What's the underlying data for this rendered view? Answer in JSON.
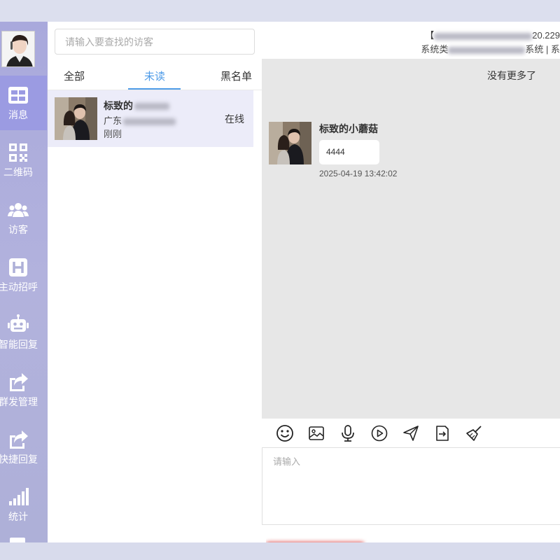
{
  "colors": {
    "accent": "#4e9be8",
    "sidebar": "#aeb0d8",
    "sidebar_active": "#9b9be2",
    "selected_row": "#ececf9",
    "chat_bg": "#e7e7e7"
  },
  "sidebar": {
    "items": [
      {
        "label": "消息",
        "icon": "message-grid-icon"
      },
      {
        "label": "二维码",
        "icon": "qrcode-icon"
      },
      {
        "label": "访客",
        "icon": "users-icon"
      },
      {
        "label": "主动招呼",
        "icon": "h-square-icon"
      },
      {
        "label": "智能回复",
        "icon": "robot-icon"
      },
      {
        "label": "群发管理",
        "icon": "share-icon"
      },
      {
        "label": "快捷回复",
        "icon": "share-icon"
      },
      {
        "label": "统计",
        "icon": "signal-bars-icon"
      }
    ]
  },
  "search": {
    "placeholder": "请输入要查找的访客"
  },
  "tabs": [
    {
      "label": "全部"
    },
    {
      "label": "未读"
    },
    {
      "label": "黑名单"
    }
  ],
  "conversation": {
    "name": "标致的",
    "location": "广东",
    "time": "刚刚",
    "status": "在线"
  },
  "header": {
    "line1": "20.229",
    "line2_start": "系统类",
    "line2_end": "系统 | 系"
  },
  "chat": {
    "no_more": "没有更多了",
    "message": {
      "sender": "标致的小蘑菇",
      "text": "4444",
      "time": "2025-04-19 13:42:02"
    }
  },
  "toolbar": {
    "tools": [
      "emoji-icon",
      "image-icon",
      "microphone-icon",
      "video-play-icon",
      "send-plane-icon",
      "file-transfer-icon",
      "broom-clear-icon"
    ]
  },
  "input": {
    "placeholder": "请输入"
  }
}
